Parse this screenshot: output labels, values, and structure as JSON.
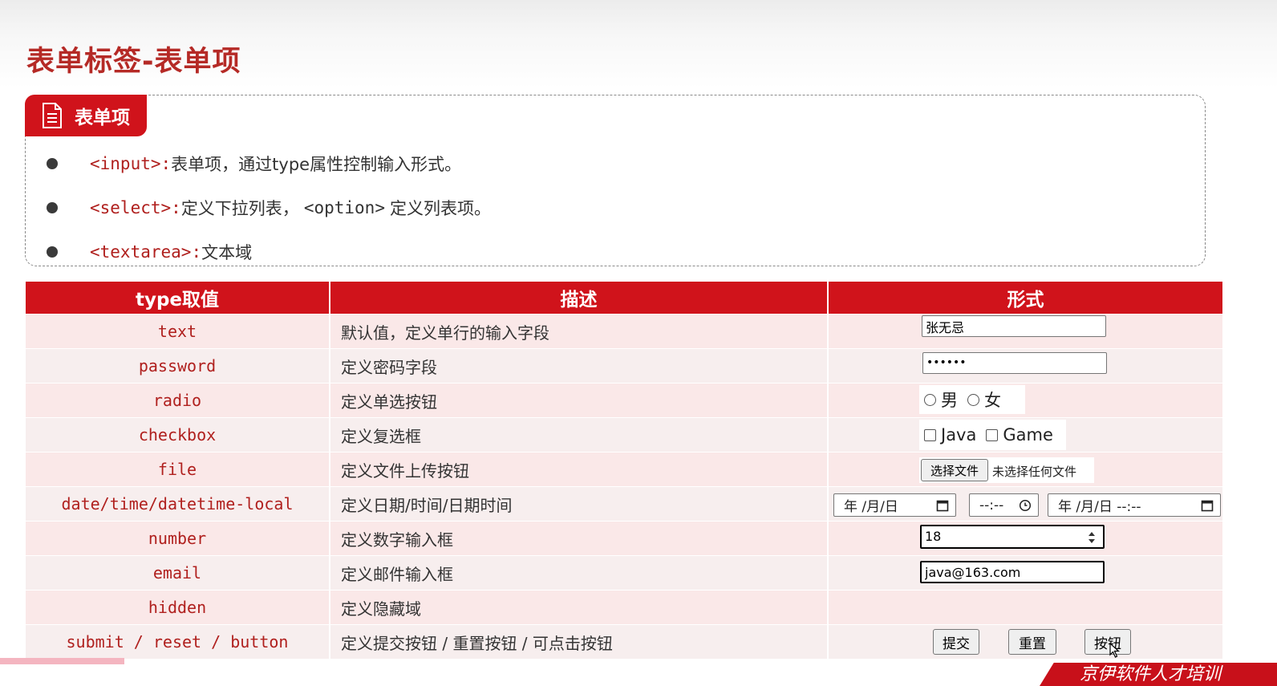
{
  "page": {
    "title": "表单标签-表单项"
  },
  "card": {
    "badge": "表单项",
    "bullets": [
      {
        "tag": "<input>",
        "sep": ":",
        "text": "表单项，通过type属性控制输入形式。"
      },
      {
        "tag": "<select>",
        "sep": ":",
        "text": "定义下拉列表，",
        "tag2": "<option>",
        "text2": "定义列表项。"
      },
      {
        "tag": "<textarea>",
        "sep": ":",
        "text": "文本域"
      }
    ]
  },
  "table": {
    "headers": [
      "type取值",
      "描述",
      "形式"
    ],
    "rows": [
      {
        "type": "text",
        "desc": "默认值，定义单行的输入字段"
      },
      {
        "type": "password",
        "desc": "定义密码字段"
      },
      {
        "type": "radio",
        "desc": "定义单选按钮"
      },
      {
        "type": "checkbox",
        "desc": "定义复选框"
      },
      {
        "type": "file",
        "desc": "定义文件上传按钮"
      },
      {
        "type": "date/time/datetime-local",
        "desc": "定义日期/时间/日期时间"
      },
      {
        "type": "number",
        "desc": "定义数字输入框"
      },
      {
        "type": "email",
        "desc": "定义邮件输入框"
      },
      {
        "type": "hidden",
        "desc": "定义隐藏域"
      },
      {
        "type": "submit / reset / button",
        "desc": "定义提交按钮 / 重置按钮 / 可点击按钮"
      }
    ]
  },
  "demo": {
    "text_value": "张无忌",
    "password_value": "••••••",
    "radio_options": [
      "男",
      "女"
    ],
    "checkbox_options": [
      "Java",
      "Game"
    ],
    "file_button": "选择文件",
    "file_status": "未选择任何文件",
    "date_placeholder": "年 /月/日",
    "time_placeholder": "--:--",
    "datetime_placeholder": "年 /月/日 --:--",
    "number_value": "18",
    "email_value": "java@163.com",
    "buttons": [
      "提交",
      "重置",
      "按钮"
    ]
  },
  "footer": {
    "logo_text": "京伊软件人才培训"
  }
}
